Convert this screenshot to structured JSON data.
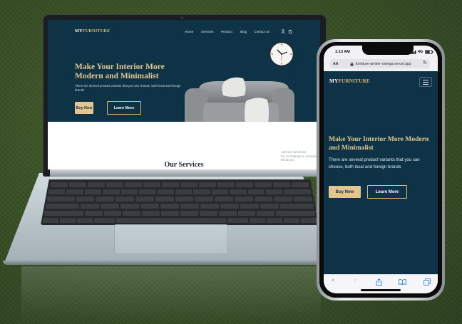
{
  "laptop": {
    "brand": {
      "prefix": "MY",
      "suffix": "FURNITURE"
    },
    "nav": [
      "Home",
      "Services",
      "Product",
      "Blog",
      "Contact us"
    ],
    "nav_icons": [
      "user-icon",
      "cart-icon"
    ],
    "hero": {
      "title": "Make Your Interior More Modern and Minimalist",
      "subtitle": "There are several product variants that you can choose, both local and foreign brands",
      "buy_label": "Buy Now",
      "learn_label": "Learn More"
    },
    "section_heading": "Our Services",
    "watermark_line1": "Activate Windows",
    "watermark_line2": "Go to Settings to activate Windows."
  },
  "phone": {
    "status_time": "1:13 AM",
    "status_network": "4G",
    "url_aa": "AA",
    "url": "furniture-amber-omega.vercel.app",
    "brand": {
      "prefix": "MY",
      "suffix": "FURNITURE"
    },
    "hero": {
      "title": "Make Your Interior More Modern and Minimalist",
      "subtitle": "There are several product variants that you can choose, both local and foreign brands",
      "buy_label": "Buy Now",
      "learn_label": "Learn More"
    },
    "toolbar_icons": [
      "back-icon",
      "forward-icon",
      "share-icon",
      "bookmarks-icon",
      "tabs-icon"
    ]
  },
  "colors": {
    "hero_bg": "#0e3347",
    "accent_gold": "#e2c58f",
    "backdrop": "#3a5226"
  }
}
